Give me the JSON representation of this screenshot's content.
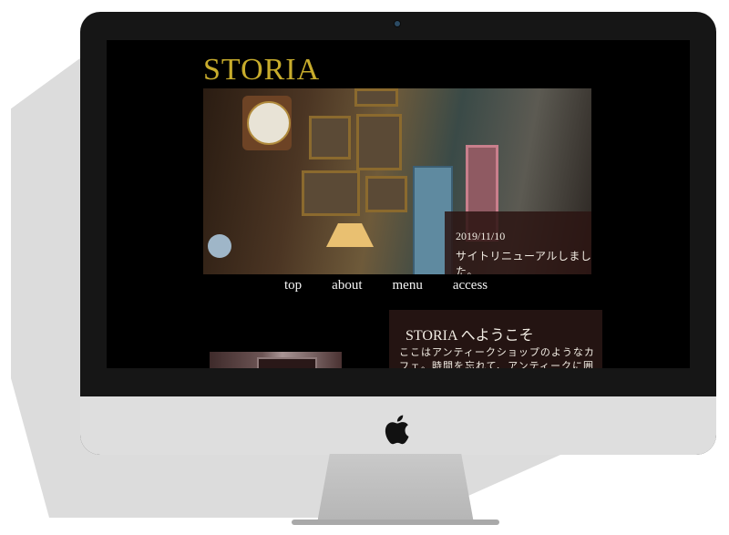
{
  "site": {
    "logo": "STORIA",
    "news": {
      "date": "2019/11/10",
      "text": "サイトリニューアルしました。"
    },
    "nav": [
      {
        "label": "top"
      },
      {
        "label": "about"
      },
      {
        "label": "menu"
      },
      {
        "label": "access"
      }
    ],
    "welcome": {
      "title": "STORIA へようこそ",
      "body": "ここはアンティークショップのようなカフェ。時間を忘れて、アンティークに囲まれた"
    }
  },
  "device": {
    "type": "desktop monitor mockup",
    "brand_icon": "apple-icon",
    "bezel_color": "#161616",
    "chin_color": "#dedede"
  },
  "colors": {
    "accent": "#c8ac2c",
    "background": "#000000",
    "panel": "#241412",
    "text": "#f2ede4"
  }
}
